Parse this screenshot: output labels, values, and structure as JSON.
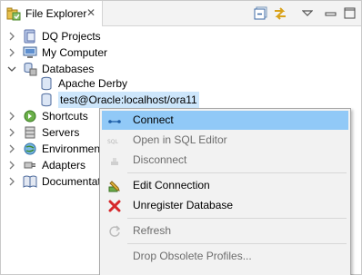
{
  "tab": {
    "title": "File Explorer",
    "close": "✕"
  },
  "toolbar": {
    "collapse_icon": "collapse-all-icon",
    "link_icon": "link-with-editor-icon",
    "menu_icon": "view-menu-icon",
    "minimize_icon": "minimize-icon",
    "maximize_icon": "maximize-icon"
  },
  "tree": [
    {
      "label": "DQ Projects",
      "icon": "project-icon",
      "expanded": false,
      "level": 0
    },
    {
      "label": "My Computer",
      "icon": "computer-icon",
      "expanded": false,
      "level": 0
    },
    {
      "label": "Databases",
      "icon": "databases-icon",
      "expanded": true,
      "level": 0
    },
    {
      "label": "Apache Derby",
      "icon": "database-icon",
      "level": 1
    },
    {
      "label": "test@Oracle:localhost/ora11",
      "icon": "database-icon",
      "level": 1,
      "selected": true
    },
    {
      "label": "Shortcuts",
      "icon": "shortcuts-icon",
      "expanded": false,
      "level": 0
    },
    {
      "label": "Servers",
      "icon": "servers-icon",
      "expanded": false,
      "level": 0
    },
    {
      "label": "Environment",
      "icon": "environment-icon",
      "expanded": false,
      "level": 0
    },
    {
      "label": "Adapters",
      "icon": "adapters-icon",
      "expanded": false,
      "level": 0
    },
    {
      "label": "Documentation",
      "icon": "documentation-icon",
      "expanded": false,
      "level": 0
    }
  ],
  "context_menu": {
    "items": [
      {
        "label": "Connect",
        "icon": "connect-icon",
        "enabled": true,
        "hovered": true
      },
      {
        "label": "Open in SQL Editor",
        "icon": "sql-icon",
        "enabled": false
      },
      {
        "label": "Disconnect",
        "icon": "disconnect-icon",
        "enabled": false
      },
      {
        "label": "Edit Connection",
        "icon": "edit-connection-icon",
        "enabled": true
      },
      {
        "label": "Unregister Database",
        "icon": "unregister-icon",
        "enabled": true
      },
      {
        "label": "Refresh",
        "icon": "refresh-icon",
        "enabled": false
      },
      {
        "label": "Drop Obsolete Profiles...",
        "icon": "",
        "enabled": false
      }
    ]
  },
  "colors": {
    "hover": "#91c9f7",
    "selected": "#cde6fb",
    "menu_bg": "#f2f2f2",
    "disabled_text": "#6d6d6d"
  }
}
